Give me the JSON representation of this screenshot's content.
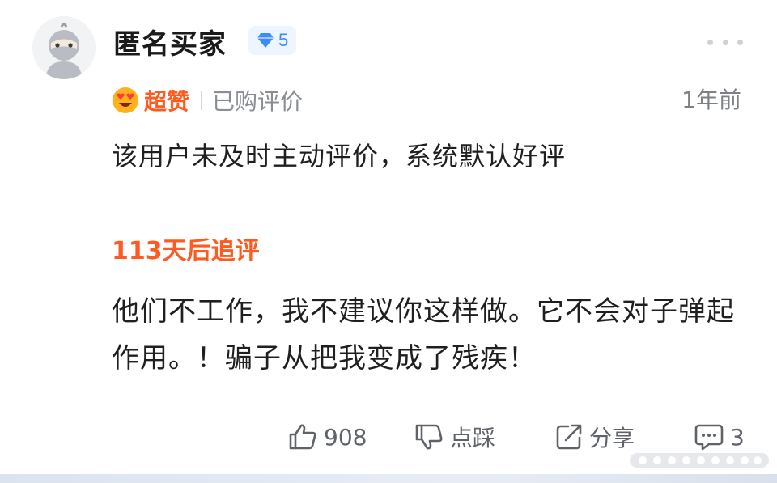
{
  "user": {
    "name": "匿名买家",
    "level": "5",
    "avatar_icon": "anonymous-ninja-avatar",
    "level_icon": "diamond-icon"
  },
  "review": {
    "rating_label": "超赞",
    "rating_icon": "heart-eyes-emoji-icon",
    "purchase_label": "已购评价",
    "time": "1年前",
    "text": "该用户未及时主动评价，系统默认好评"
  },
  "followup": {
    "title": "113天后追评",
    "text": "他们不工作，我不建议你这样做。它不会对子弹起作用。！骗子从把我变成了残疾！"
  },
  "actions": {
    "like_count": "908",
    "dislike_label": "点踩",
    "share_label": "分享",
    "comment_count": "3"
  },
  "colors": {
    "accent_orange": "#ff5a1f",
    "level_blue": "#3a8dff",
    "muted_text": "#8a8d93"
  }
}
